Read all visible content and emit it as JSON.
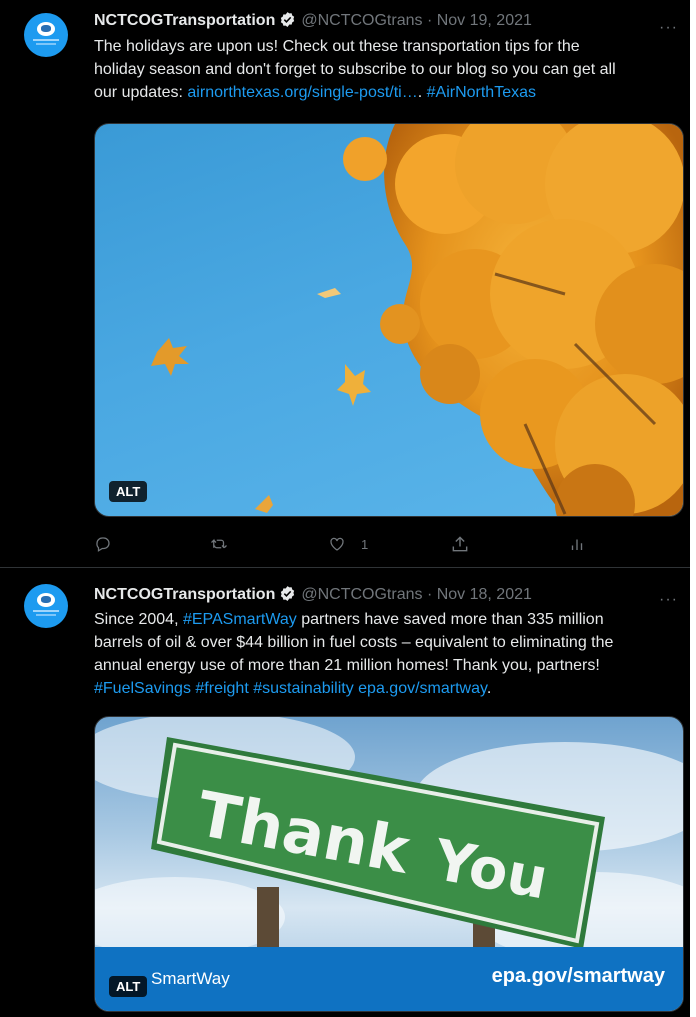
{
  "tweets": [
    {
      "name": "NCTCOGTransportation",
      "handle": "@NCTCOGtrans",
      "separator": "·",
      "date": "Nov 19, 2021",
      "more": "···",
      "line1": "The holidays are upon us! Check out these transportation tips for the",
      "line2": "holiday season and don't forget to subscribe to our blog so you can get all",
      "line3_text": "our updates: ",
      "line3_link": "airnorthtexas.org/single-post/ti…",
      "line3_sep": ". ",
      "line3_hashtag": "#AirNorthTexas",
      "alt_label": "ALT",
      "actions": {
        "reply_count": "",
        "retweet_count": "",
        "like_count": "1"
      }
    },
    {
      "name": "NCTCOGTransportation",
      "handle": "@NCTCOGtrans",
      "separator": "·",
      "date": "Nov 18, 2021",
      "more": "···",
      "line1_pre": "Since 2004, ",
      "line1_hashtag": "#EPASmartWay",
      "line1_post": " partners have saved more than 335 million",
      "line2": "barrels of oil & over $44 billion in fuel costs – equivalent to eliminating the",
      "line3": "annual energy use of more than 21 million homes! Thank you, partners!",
      "line4_tags": "#FuelSavings #freight #sustainability",
      "line4_space": " ",
      "line4_link": "epa.gov/smartway",
      "line4_end": ".",
      "sign_word1": "Thank",
      "sign_word2": "You",
      "brand": "SmartWay",
      "brand_url": "epa.gov/smartway",
      "alt_label": "ALT"
    }
  ],
  "colors": {
    "link": "#1d9bf0",
    "text": "#e7e9ea",
    "muted": "#71767b",
    "background": "#000000"
  }
}
